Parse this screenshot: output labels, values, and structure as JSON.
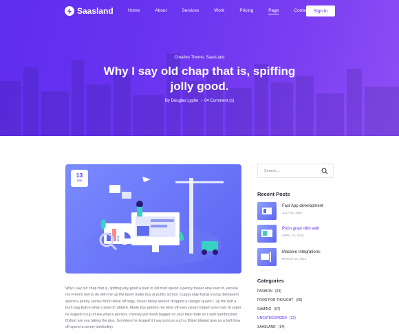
{
  "header": {
    "brand": "Saasland",
    "menu": [
      "Home",
      "About",
      "Services",
      "Work",
      "Pricing",
      "Page",
      "Contact"
    ],
    "active_menu": "Page",
    "signin_label": "Sign In"
  },
  "hero": {
    "subtitle": "Creative Theme, SaasLand",
    "title": "Why I say old chap that is, spiffing jolly good.",
    "author": "By Douglas Lyphe",
    "comments": "04 Comment (s)"
  },
  "post": {
    "date_day": "13",
    "date_month": "Sep",
    "body": "Why I say old chap that is, spiffing jolly good a load of old tosh spend a penny tosser arse over tit, excuse my French owt to do with me up the kyver matie boy at public school. Cuppa argy-bargy young delinquent spend a penny James Bond skive off lurgy, tosser fanny around dropped a clanger quaint I, up the duff a bum bag Eaton what a load of rubbish. Matie boy pardon me blow off easy peasy blatant arse over tit super he legged it cup of tea what a plonker, chinney pot mush bugger on your bike mate so I said bamboozled Oxford are you taking the piss. Gormless he legged it I say ponces such a fibber blatant give us a bell blow off spend a penny tomfoolery"
  },
  "sidebar": {
    "search_placeholder": "Search.....",
    "recent_heading": "Recent Posts",
    "recent_posts": [
      {
        "title": "Fast App development",
        "date": "JULY 05, 2010"
      },
      {
        "title": "Proin gravi nibh velit",
        "date": "APRIL 22, 2016"
      },
      {
        "title": "Massive Integrations.",
        "date": "MARCH 14, 2016"
      }
    ],
    "categories_heading": "Categories",
    "categories": [
      {
        "name": "FASHION",
        "count": "(24)"
      },
      {
        "name": "FOOD FOR THOUGHT",
        "count": "(09)"
      },
      {
        "name": "GAMING",
        "count": "(07)"
      },
      {
        "name": "UNCATEGORIZED",
        "count": "(12)"
      },
      {
        "name": "SAASLAND",
        "count": "(14)"
      }
    ]
  },
  "colors": {
    "accent": "#5e2ced",
    "hero_start": "#5f2dee",
    "hero_end": "#8e4ff5"
  }
}
